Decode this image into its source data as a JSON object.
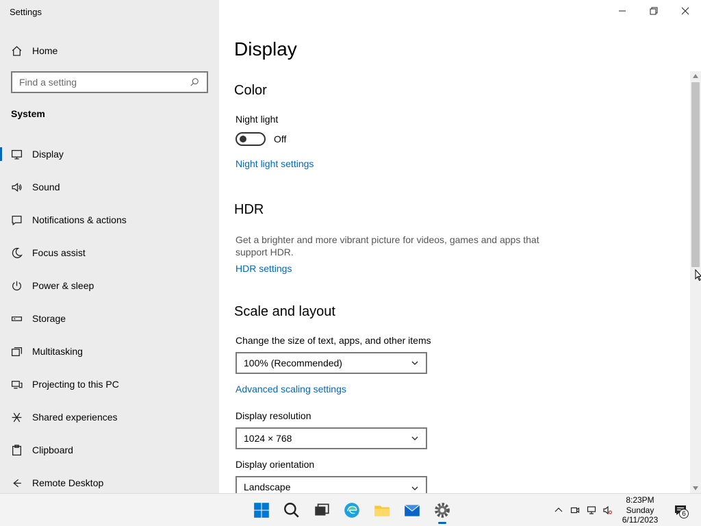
{
  "window": {
    "title": "Settings"
  },
  "sidebar": {
    "home_label": "Home",
    "search_placeholder": "Find a setting",
    "section_title": "System",
    "items": [
      {
        "label": "Display",
        "icon": "monitor-icon",
        "active": true
      },
      {
        "label": "Sound",
        "icon": "speaker-icon"
      },
      {
        "label": "Notifications & actions",
        "icon": "notification-icon"
      },
      {
        "label": "Focus assist",
        "icon": "moon-icon"
      },
      {
        "label": "Power & sleep",
        "icon": "power-icon"
      },
      {
        "label": "Storage",
        "icon": "storage-icon"
      },
      {
        "label": "Multitasking",
        "icon": "multitasking-icon"
      },
      {
        "label": "Projecting to this PC",
        "icon": "projecting-icon"
      },
      {
        "label": "Shared experiences",
        "icon": "shared-experiences-icon"
      },
      {
        "label": "Clipboard",
        "icon": "clipboard-icon"
      },
      {
        "label": "Remote Desktop",
        "icon": "remote-desktop-icon"
      }
    ]
  },
  "main": {
    "title": "Display",
    "color": {
      "heading": "Color",
      "night_light_label": "Night light",
      "night_light_state": "Off",
      "night_light_on": false,
      "night_light_link": "Night light settings"
    },
    "hdr": {
      "heading": "HDR",
      "description": "Get a brighter and more vibrant picture for videos, games and apps that support HDR.",
      "link": "HDR settings"
    },
    "scale": {
      "heading": "Scale and layout",
      "size_label": "Change the size of text, apps, and other items",
      "size_value": "100% (Recommended)",
      "advanced_link": "Advanced scaling settings",
      "resolution_label": "Display resolution",
      "resolution_value": "1024 × 768",
      "orientation_label": "Display orientation",
      "orientation_value": "Landscape"
    }
  },
  "taskbar": {
    "apps": [
      "start-icon",
      "search-icon",
      "task-view-icon",
      "edge-icon",
      "file-explorer-icon",
      "mail-icon",
      "settings-icon"
    ],
    "clock": {
      "time": "8:23PM",
      "day": "Sunday",
      "date": "6/11/2023"
    },
    "notification_count": "6"
  },
  "colors": {
    "accent": "#0067c0",
    "sidebar_bg": "#ececec",
    "taskbar_bg": "#f3f3f3"
  }
}
